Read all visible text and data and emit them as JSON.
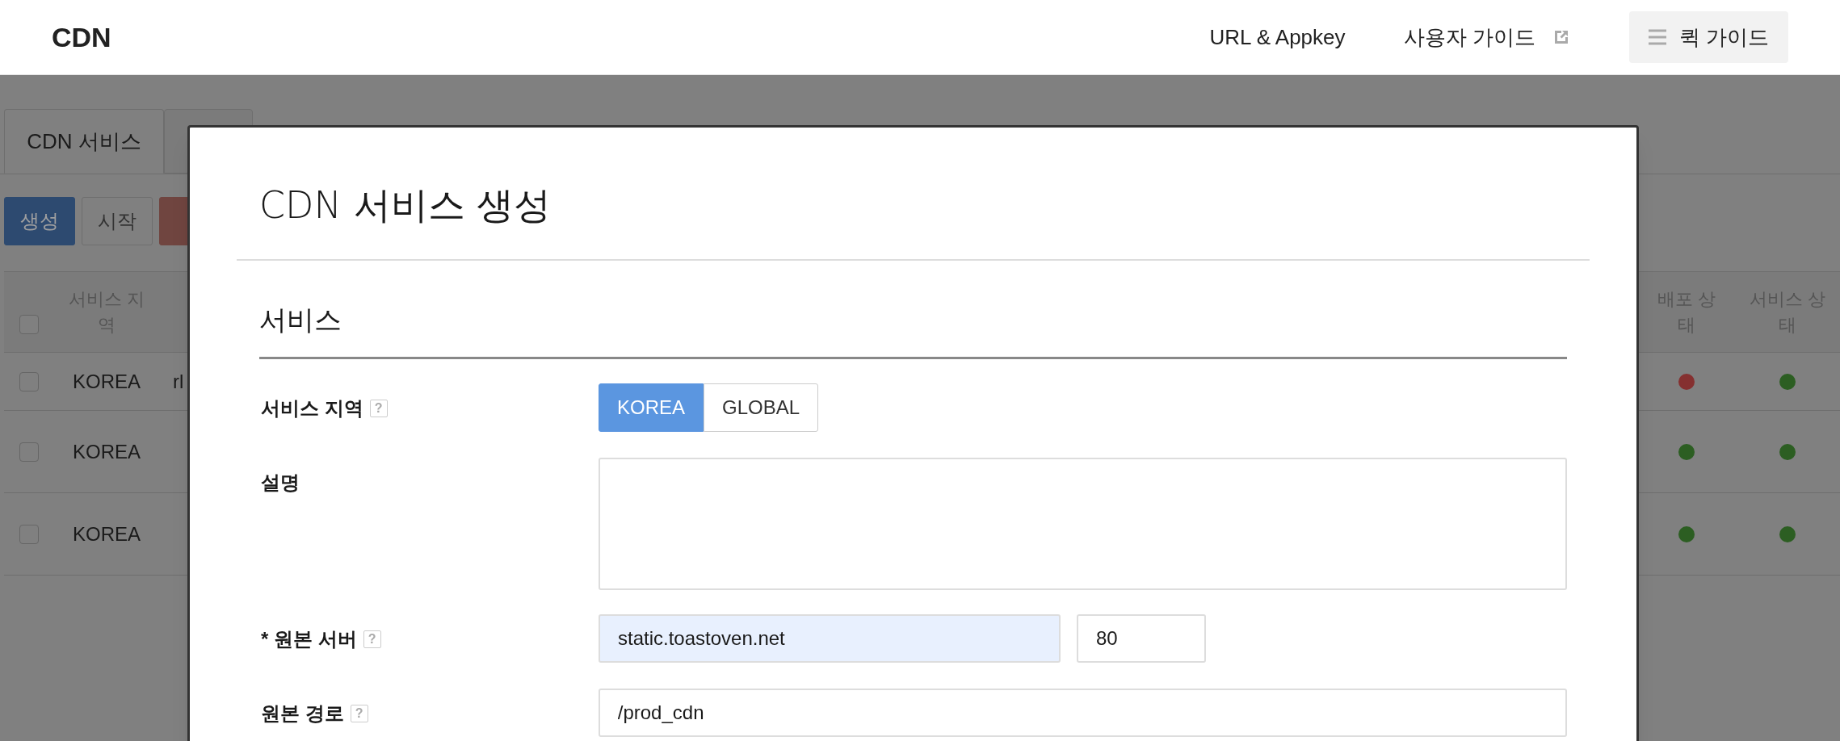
{
  "header": {
    "logo": "CDN",
    "links": [
      {
        "label": "URL & Appkey",
        "kind": "plain"
      },
      {
        "label": "사용자 가이드",
        "kind": "external"
      },
      {
        "label": "퀵 가이드",
        "kind": "menu"
      }
    ]
  },
  "tabs": [
    {
      "label": "CDN 서비스",
      "selected": true
    },
    {
      "selected": false
    }
  ],
  "toolbar": [
    {
      "label": "생성",
      "kind": "primary"
    },
    {
      "label": "시작",
      "kind": "default"
    },
    {
      "kind": "danger"
    }
  ],
  "table": {
    "header_checked": false,
    "columns": {
      "region": "서비스 지역",
      "deploy_status": "배포 상태",
      "service_status": "서비스 상태"
    },
    "rows": [
      {
        "checked": false,
        "region": "KOREA",
        "column_3": "rl",
        "deploy": {
          "color": "#853030"
        },
        "service": {
          "color": "#2c5e22"
        }
      },
      {
        "checked": false,
        "region": "KOREA",
        "deploy": {
          "color": "#2c5e22"
        },
        "service": {
          "color": "#2c5e22"
        }
      },
      {
        "checked": false,
        "region": "KOREA",
        "deploy": {
          "color": "#2c5e22"
        },
        "service": {
          "color": "#2c5e22"
        }
      }
    ]
  },
  "modal": {
    "title": "CDN 서비스 생성",
    "section": "서비스",
    "fields": [
      {
        "kind": "segmented",
        "label": "서비스 지역",
        "help": "?",
        "options": [
          {
            "label": "KOREA",
            "selected": true
          },
          {
            "label": "GLOBAL",
            "selected": false
          }
        ]
      },
      {
        "kind": "textarea",
        "label": "설명"
      },
      {
        "kind": "host_port",
        "label": "* 원본 서버",
        "help": "?",
        "value": "static.toastoven.net",
        "autofilled": true,
        "port": "80"
      },
      {
        "kind": "text",
        "label": "원본 경로",
        "help": "?",
        "value": "/prod_cdn"
      }
    ]
  }
}
